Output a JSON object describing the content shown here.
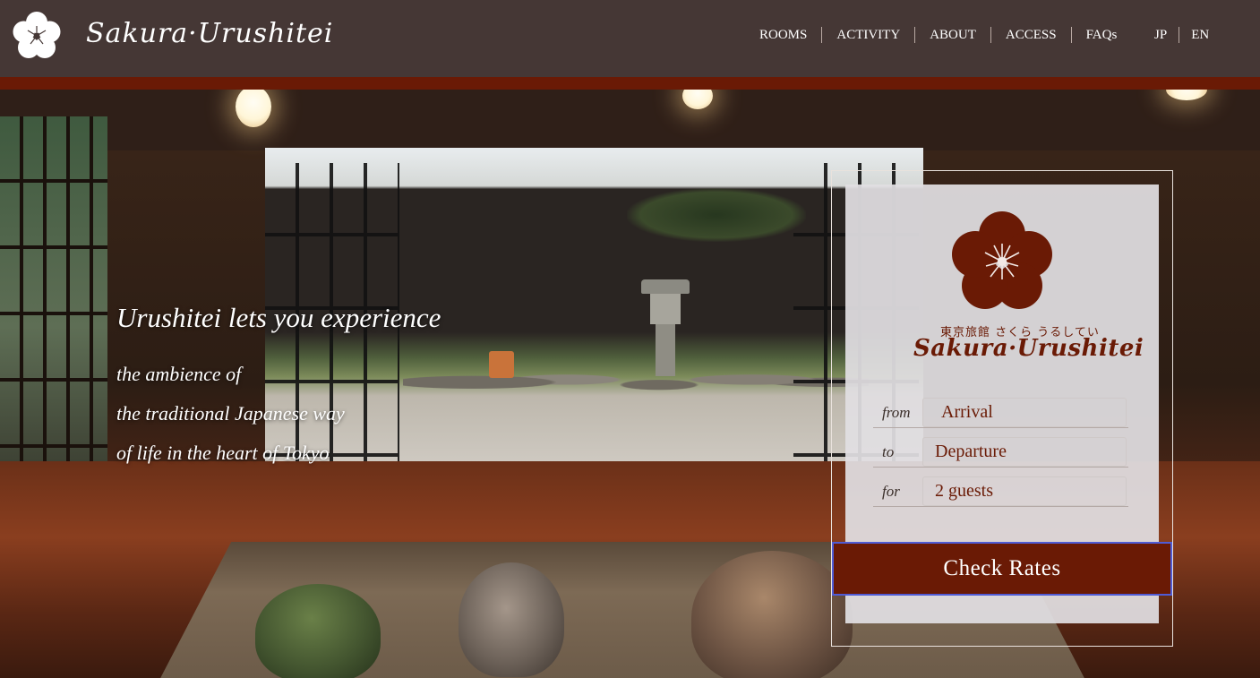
{
  "header": {
    "brand": "Sakura·Urushitei",
    "nav": [
      "ROOMS",
      "ACTIVITY",
      "ABOUT",
      "ACCESS",
      "FAQs"
    ],
    "languages": [
      "JP",
      "EN"
    ]
  },
  "hero": {
    "title": "Urushitei lets you experience",
    "lines": [
      "the ambience of",
      "the traditional Japanese way",
      "of life in the heart of Tokyo"
    ]
  },
  "booking": {
    "logo_subtitle": "東京旅館 さくら うるしてい",
    "logo_brand": "Sakura·Urushitei",
    "from_label": "from",
    "to_label": "to",
    "for_label": "for",
    "arrival": "Arrival",
    "departure": "Departure",
    "guests": "2 guests",
    "button": "Check Rates"
  },
  "colors": {
    "header_bg": "#453735",
    "accent": "#6a1a05",
    "panel_bg": "#e1dfe2"
  }
}
